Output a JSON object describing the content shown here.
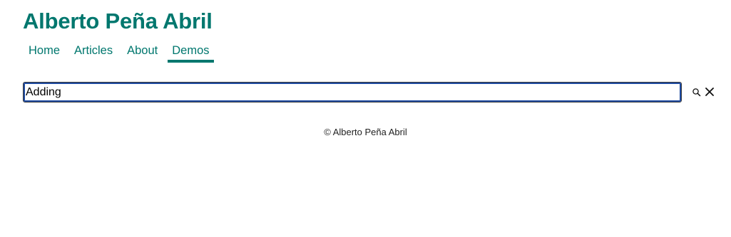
{
  "site": {
    "title": "Alberto Peña Abril"
  },
  "nav": {
    "items": [
      {
        "label": "Home"
      },
      {
        "label": "Articles"
      },
      {
        "label": "About"
      },
      {
        "label": "Demos"
      }
    ],
    "active": "Demos"
  },
  "search": {
    "value": "Adding",
    "search_icon": "search-icon",
    "clear_icon": "close-icon"
  },
  "footer": {
    "copyright": "© Alberto Peña Abril"
  },
  "colors": {
    "accent": "#00776e",
    "focus_ring": "#1e4aa0"
  }
}
